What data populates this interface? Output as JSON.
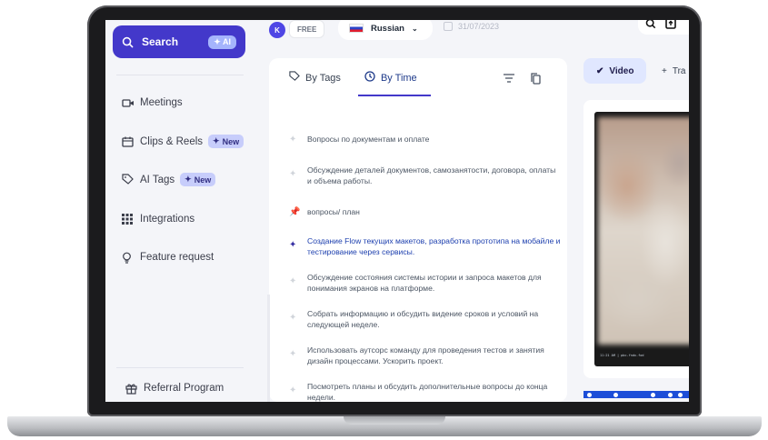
{
  "sidebar": {
    "search_label": "Search",
    "ai_label": "AI",
    "items": [
      {
        "label": "Meetings",
        "icon": "video-icon"
      },
      {
        "label": "Clips & Reels",
        "icon": "clips-icon",
        "badge": "New"
      },
      {
        "label": "AI Tags",
        "icon": "tag-icon",
        "badge": "New"
      },
      {
        "label": "Integrations",
        "icon": "grid-icon"
      },
      {
        "label": "Feature request",
        "icon": "lightbulb-icon"
      }
    ],
    "referral_label": "Referral Program"
  },
  "header": {
    "avatar_initials": "K",
    "plan_badge": "FREE",
    "language": "Russian",
    "date": "31/07/2023"
  },
  "panel": {
    "tabs": [
      {
        "label": "By Tags",
        "active": false
      },
      {
        "label": "By Time",
        "active": true
      }
    ],
    "topics": [
      {
        "text": "Вопросы по документам и оплате",
        "active": false
      },
      {
        "text": "Обсуждение деталей документов, самозанятости, договора, оплаты и объема работы.",
        "active": false
      },
      {
        "text": "вопросы/ план",
        "active": false
      },
      {
        "text": "Создание Flow текущих макетов, разработка прототипа на мобайле и тестирование через сервисы.",
        "active": true
      },
      {
        "text": "Обсуждение состояния системы истории и запроса макетов для понимания экранов на платформе.",
        "active": false
      },
      {
        "text": "Собрать информацию и обсудить видение сроков и условий на следующей неделе.",
        "active": false
      },
      {
        "text": "Использовать аутсорс команду для проведения тестов и занятия дизайн процессами. Ускорить проект.",
        "active": false
      },
      {
        "text": "Посмотреть планы и обсудить дополнительные вопросы до конца недели.",
        "active": false
      }
    ]
  },
  "right": {
    "video_tab": "Video",
    "second_tab": "Tra",
    "video_caption": "11:21 AM  |  pbc-fndx-fod"
  },
  "colors": {
    "accent": "#4338ca",
    "sidebar_bg": "#f4f5f9",
    "new_badge": "#c7cdfb"
  }
}
